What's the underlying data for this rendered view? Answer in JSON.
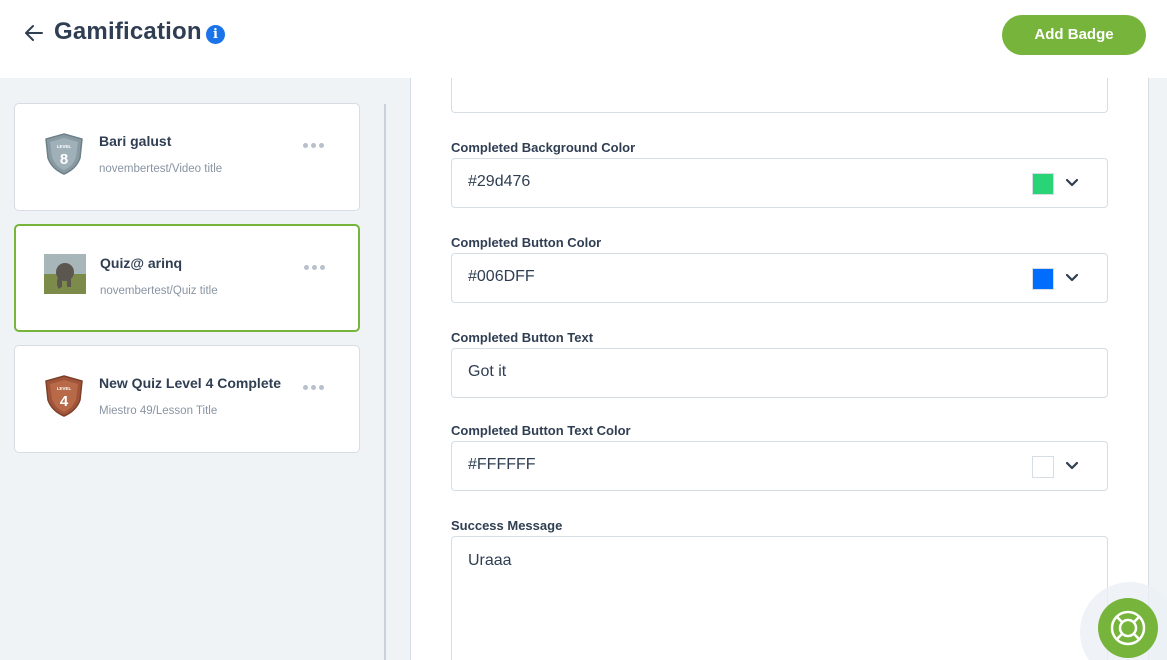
{
  "header": {
    "title": "Gamification",
    "add_badge_label": "Add Badge"
  },
  "badges": [
    {
      "title": "Bari galust",
      "subtitle": "novembertest/Video title",
      "icon": "level-8-shield",
      "level": "8",
      "level_label": "LEVEL"
    },
    {
      "title": "Quiz@ arinq",
      "subtitle": "novembertest/Quiz title",
      "icon": "elephant-photo"
    },
    {
      "title": "New Quiz Level 4 Complete",
      "subtitle": "Miestro 49/Lesson Title",
      "icon": "level-4-shield",
      "level": "4",
      "level_label": "LEVEL"
    }
  ],
  "form": {
    "completed_bg_color": {
      "label": "Completed Background Color",
      "value": "#29d476",
      "swatch": "#29d476"
    },
    "completed_button_color": {
      "label": "Completed Button Color",
      "value": "#006DFF",
      "swatch": "#006DFF"
    },
    "completed_button_text": {
      "label": "Completed Button Text",
      "value": "Got it"
    },
    "completed_button_text_color": {
      "label": "Completed Button Text Color",
      "value": "#FFFFFF",
      "swatch": "#FFFFFF"
    },
    "success_message": {
      "label": "Success Message",
      "value": "Uraaa"
    }
  },
  "colors": {
    "accent_green": "#76b43b",
    "info_blue": "#1a73e8",
    "text_dark": "#2f3e52"
  }
}
